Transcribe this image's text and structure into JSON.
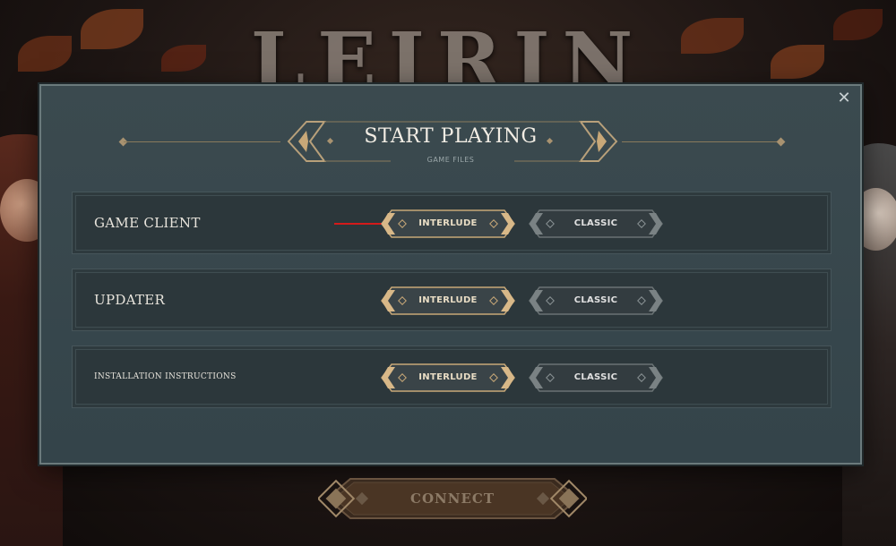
{
  "background": {
    "logo_text": "LEIRIN"
  },
  "modal": {
    "title": "START PLAYING",
    "subtitle": "GAME FILES",
    "close_icon": "close-icon"
  },
  "rows": [
    {
      "label": "GAME CLIENT",
      "interlude": "INTERLUDE",
      "classic": "CLASSIC"
    },
    {
      "label": "UPDATER",
      "interlude": "INTERLUDE",
      "classic": "CLASSIC"
    },
    {
      "label": "INSTALLATION INSTRUCTIONS",
      "interlude": "INTERLUDE",
      "classic": "CLASSIC"
    }
  ],
  "connect": {
    "label": "CONNECT"
  },
  "colors": {
    "accent_gold": "#c8a878",
    "annotation_red": "#d41a1a",
    "modal_bg": "#3b4a4f"
  }
}
